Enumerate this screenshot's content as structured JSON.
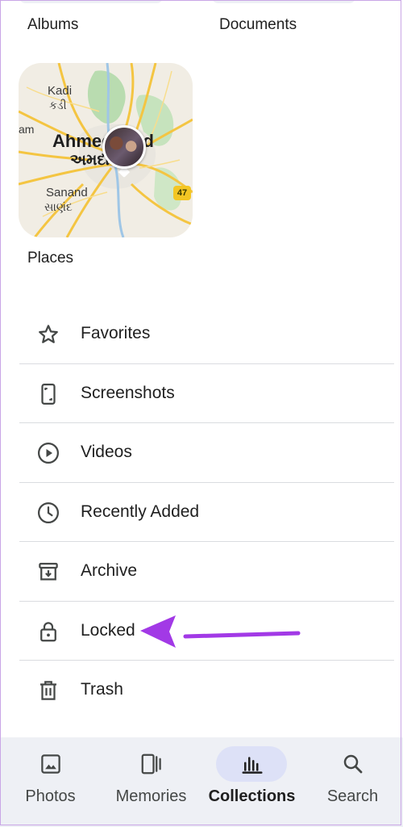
{
  "categories": {
    "albums_label": "Albums",
    "documents_label": "Documents",
    "places_label": "Places"
  },
  "places_map": {
    "city_name": "Ahmedabad",
    "city_name_local": "અમદાવાદ",
    "labels": {
      "kadi": "Kadi",
      "kadi_local": "કડી",
      "sanand": "Sanand",
      "sanand_local": "સાણંદ"
    },
    "road_badge": "47"
  },
  "utilities": [
    {
      "label": "Favorites",
      "icon": "star-icon"
    },
    {
      "label": "Screenshots",
      "icon": "screenshot-icon"
    },
    {
      "label": "Videos",
      "icon": "play-circle-icon"
    },
    {
      "label": "Recently Added",
      "icon": "clock-icon"
    },
    {
      "label": "Archive",
      "icon": "archive-icon"
    },
    {
      "label": "Locked",
      "icon": "lock-icon"
    },
    {
      "label": "Trash",
      "icon": "trash-icon"
    }
  ],
  "bottom_nav": {
    "items": [
      {
        "label": "Photos",
        "icon": "photo-icon"
      },
      {
        "label": "Memories",
        "icon": "memories-icon"
      },
      {
        "label": "Collections",
        "icon": "collections-icon",
        "active": true
      },
      {
        "label": "Search",
        "icon": "search-icon"
      }
    ]
  },
  "colors": {
    "annotation_arrow": "#a239e6",
    "nav_background": "#eef0f5",
    "nav_active_pill": "#dde1f7"
  }
}
